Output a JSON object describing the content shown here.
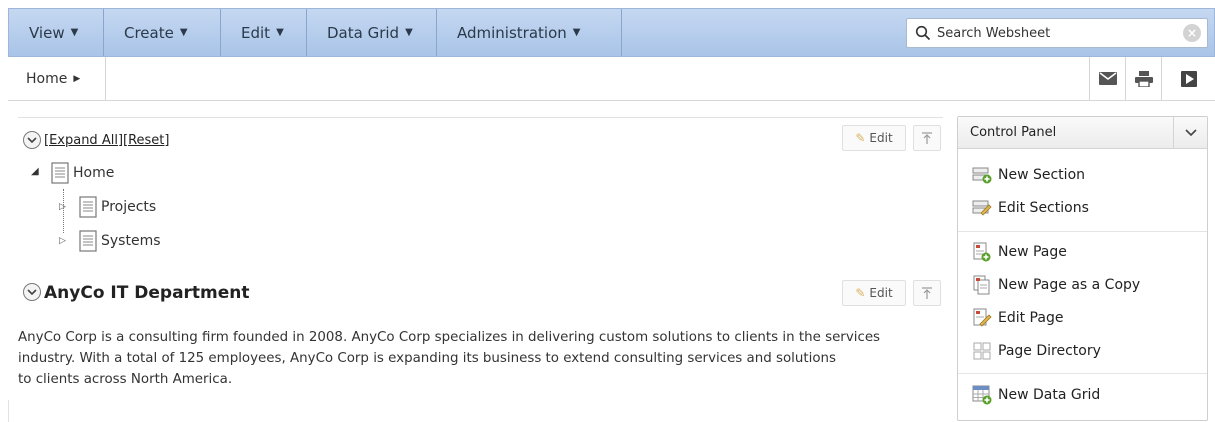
{
  "menubar": {
    "items": [
      {
        "label": "View"
      },
      {
        "label": "Create"
      },
      {
        "label": "Edit"
      },
      {
        "label": "Data Grid"
      },
      {
        "label": "Administration"
      }
    ],
    "search_placeholder": "Search Websheet"
  },
  "breadcrumb": {
    "current": "Home"
  },
  "toolbar": {
    "icons": [
      "email-icon",
      "print-icon",
      "presentation-icon"
    ]
  },
  "tree": {
    "expand_all": "[Expand All]",
    "reset": "[Reset]",
    "edit_label": "Edit",
    "root": "Home",
    "children": [
      "Projects",
      "Systems"
    ]
  },
  "section": {
    "title": "AnyCo IT Department",
    "edit_label": "Edit",
    "lines": [
      "AnyCo Corp is a consulting firm founded in 2008. AnyCo Corp specializes in delivering custom solutions to clients in the services",
      "industry. With a total of 125 employees, AnyCo Corp is expanding its business to extend consulting services and solutions",
      "to clients across North America."
    ]
  },
  "control_panel": {
    "title": "Control Panel",
    "items": [
      {
        "label": "New Section"
      },
      {
        "label": "Edit Sections"
      },
      {
        "label": "New Page"
      },
      {
        "label": "New Page as a Copy"
      },
      {
        "label": "Edit Page"
      },
      {
        "label": "Page Directory"
      },
      {
        "label": "New Data Grid"
      }
    ]
  },
  "colors": {
    "menubar": "#b7cdec",
    "accent_green": "#5aa02c",
    "pencil": "#d8b360"
  }
}
